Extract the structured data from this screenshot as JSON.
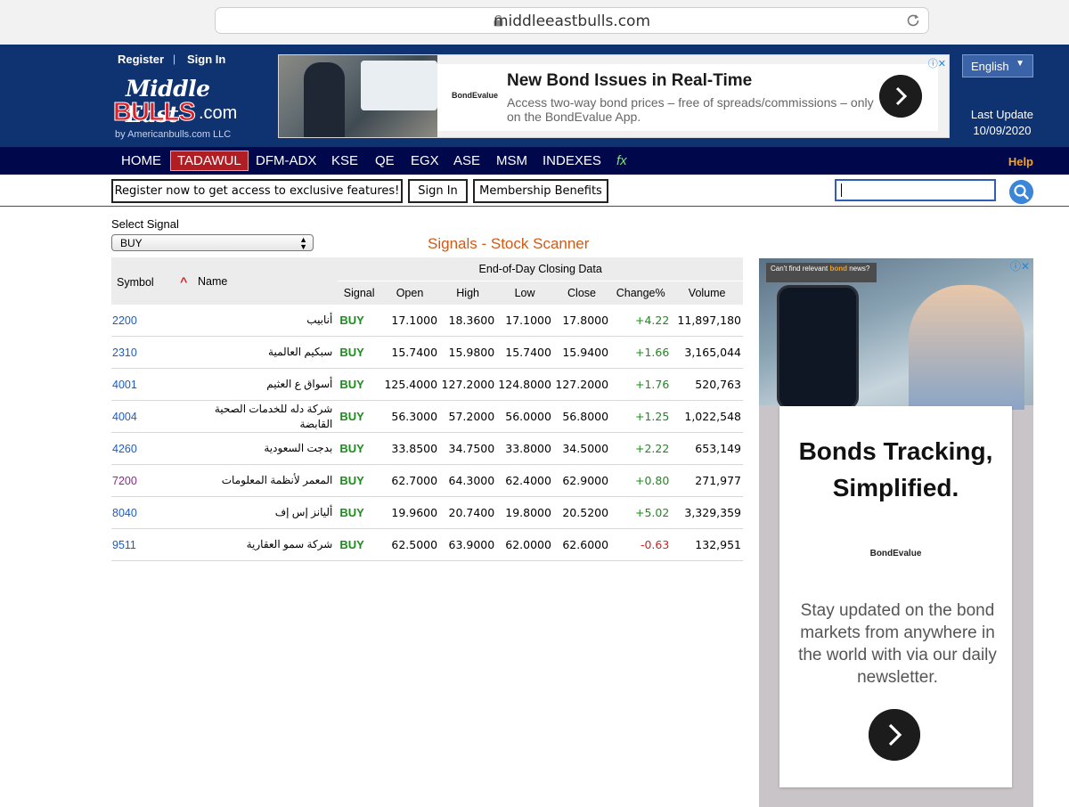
{
  "browser": {
    "url": "middleeastbulls.com"
  },
  "header": {
    "register": "Register",
    "separator": "|",
    "sign_in": "Sign In",
    "logo_top": "Middle East",
    "logo_bulls": "BULLS",
    "logo_com": ".com",
    "logo_sub": "by Americanbulls.com LLC",
    "language": "English",
    "last_update_label": "Last Update",
    "last_update_date": "10/09/2020"
  },
  "top_ad": {
    "brand": "BondEvalue",
    "title": "New Bond Issues in Real-Time",
    "description": "Access two-way bond prices – free of spreads/commissions – only on the BondEvalue App."
  },
  "nav": {
    "items": [
      "HOME",
      "TADAWUL",
      "DFM-ADX",
      "KSE",
      "QE",
      "EGX",
      "ASE",
      "MSM",
      "INDEXES",
      "fx"
    ],
    "active": "TADAWUL",
    "help": "Help"
  },
  "toolbar": {
    "register_promo": "Register now to get access to exclusive features!",
    "sign_in": "Sign In",
    "membership": "Membership Benefits",
    "search_value": ""
  },
  "signal": {
    "label": "Select Signal",
    "selected": "BUY"
  },
  "page_title": "Signals - Stock Scanner",
  "table": {
    "group_header": "End-of-Day Closing Data",
    "columns": {
      "symbol": "Symbol",
      "name": "Name",
      "signal": "Signal",
      "open": "Open",
      "high": "High",
      "low": "Low",
      "close": "Close",
      "change": "Change%",
      "volume": "Volume"
    },
    "rows": [
      {
        "symbol": "2200",
        "name": "أنابيب",
        "signal": "BUY",
        "open": "17.1000",
        "high": "18.3600",
        "low": "17.1000",
        "close": "17.8000",
        "change": "+4.22",
        "volume": "11,897,180"
      },
      {
        "symbol": "2310",
        "name": "سبكيم العالمية",
        "signal": "BUY",
        "open": "15.7400",
        "high": "15.9800",
        "low": "15.7400",
        "close": "15.9400",
        "change": "+1.66",
        "volume": "3,165,044"
      },
      {
        "symbol": "4001",
        "name": "أسواق ع العثيم",
        "signal": "BUY",
        "open": "125.4000",
        "high": "127.2000",
        "low": "124.8000",
        "close": "127.2000",
        "change": "+1.76",
        "volume": "520,763"
      },
      {
        "symbol": "4004",
        "name": "شركة دله للخدمات الصحية القابضة",
        "signal": "BUY",
        "open": "56.3000",
        "high": "57.2000",
        "low": "56.0000",
        "close": "56.8000",
        "change": "+1.25",
        "volume": "1,022,548"
      },
      {
        "symbol": "4260",
        "name": "بدجت السعودية",
        "signal": "BUY",
        "open": "33.8500",
        "high": "34.7500",
        "low": "33.8000",
        "close": "34.5000",
        "change": "+2.22",
        "volume": "653,149"
      },
      {
        "symbol": "7200",
        "name": "المعمر لأنظمة المعلومات",
        "signal": "BUY",
        "open": "62.7000",
        "high": "64.3000",
        "low": "62.4000",
        "close": "62.9000",
        "change": "+0.80",
        "volume": "271,977"
      },
      {
        "symbol": "8040",
        "name": "أليانز إس إف",
        "signal": "BUY",
        "open": "19.9600",
        "high": "20.7400",
        "low": "19.8000",
        "close": "20.5200",
        "change": "+5.02",
        "volume": "3,329,359"
      },
      {
        "symbol": "9511",
        "name": "شركة سمو العقارية",
        "signal": "BUY",
        "open": "62.5000",
        "high": "63.9000",
        "low": "62.0000",
        "close": "62.6000",
        "change": "-0.63",
        "volume": "132,951"
      }
    ]
  },
  "right_ad": {
    "tag_prefix": "Can't find relevant ",
    "tag_highlight": "bond",
    "tag_suffix": " news?",
    "headline_1": "Bonds Tracking,",
    "headline_2": "Simplified.",
    "brand": "BondEvalue",
    "body": "Stay updated on the bond markets from anywhere in the world with via our daily newsletter."
  },
  "colors": {
    "header_bg": "#0f3270",
    "nav_bg": "#00074a",
    "active_tab": "#b01e23",
    "title_orange": "#d05a18",
    "buy_green": "#1a8c1a",
    "down_red": "#d42020",
    "symbol_blue": "#1b5cc6"
  }
}
